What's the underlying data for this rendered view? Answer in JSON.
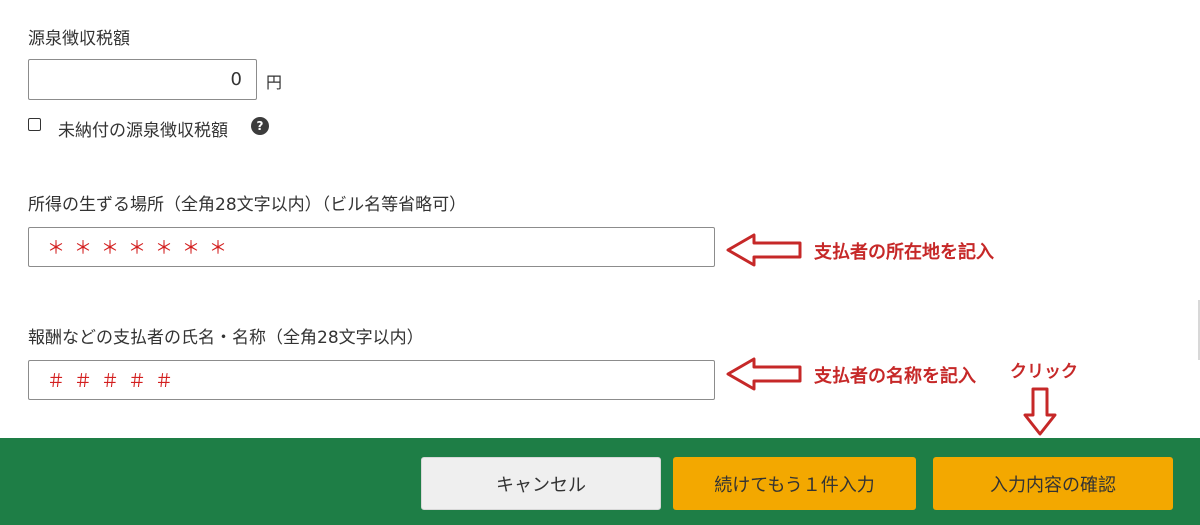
{
  "withholding": {
    "label": "源泉徴収税額",
    "value": "0",
    "unit": "円",
    "unpaid_checkbox_label": "未納付の源泉徴収税額",
    "unpaid_checked": false,
    "help_icon": "?"
  },
  "income_location": {
    "label": "所得の生ずる場所（全角28文字以内）（ビル名等省略可）",
    "value": "＊＊＊＊＊＊＊",
    "annotation": "支払者の所在地を記入"
  },
  "payer_name": {
    "label": "報酬などの支払者の氏名・名称（全角28文字以内）",
    "value": "＃＃＃＃＃",
    "annotation": "支払者の名称を記入",
    "click_annotation": "クリック"
  },
  "footer": {
    "cancel_label": "キャンセル",
    "continue_label": "続けてもう１件入力",
    "confirm_label": "入力内容の確認"
  },
  "colors": {
    "footer_bg": "#1e7e46",
    "primary_button": "#f3a800",
    "annotation": "#c62828"
  },
  "icons": {
    "help": "question-circle-icon",
    "annotation_arrow_left": "hollow-arrow-left-icon",
    "annotation_arrow_down": "hollow-arrow-down-icon"
  }
}
